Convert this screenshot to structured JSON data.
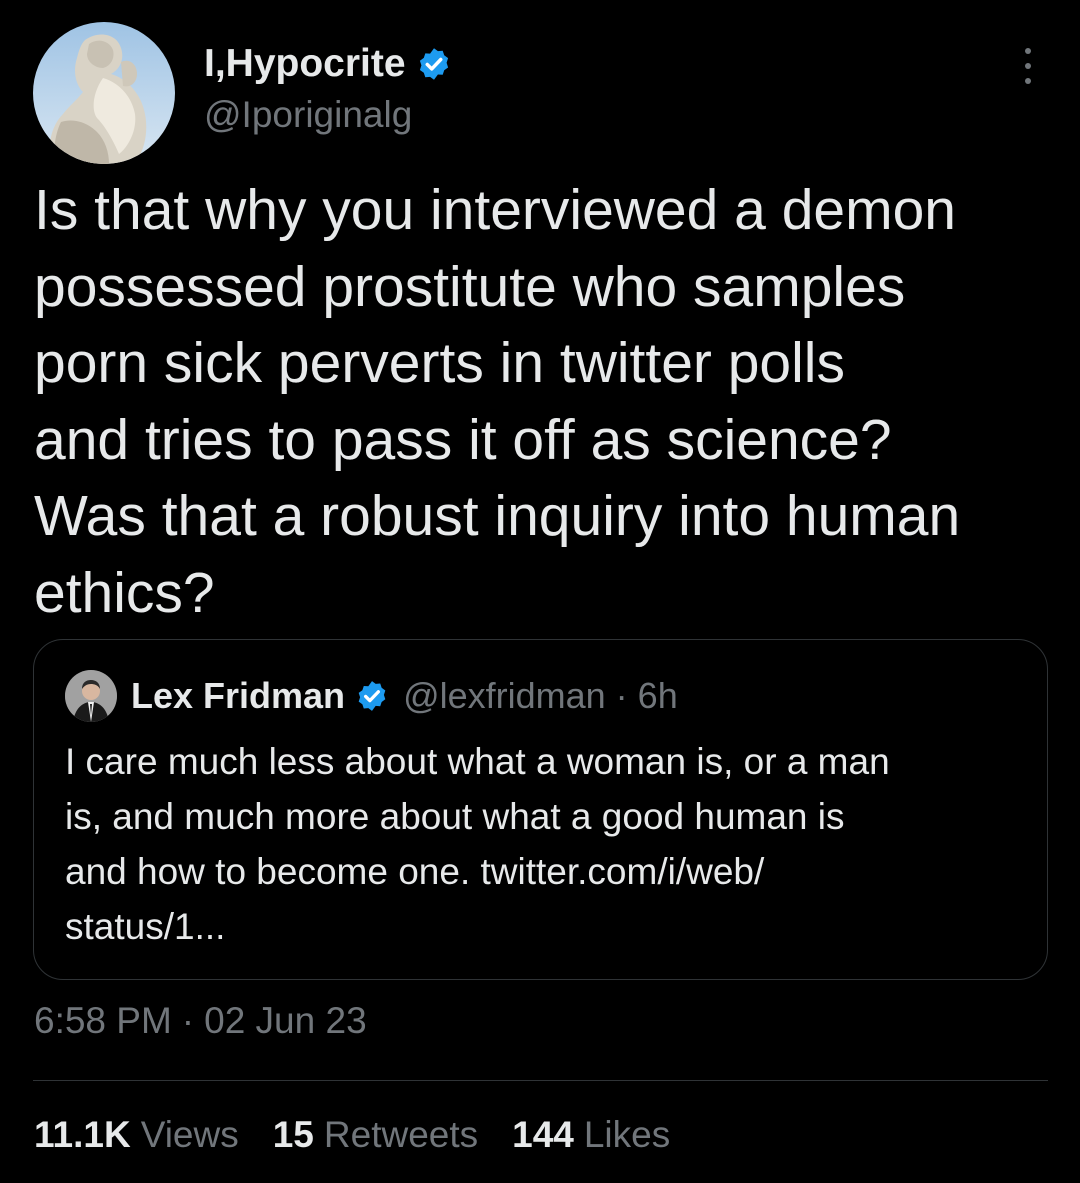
{
  "colors": {
    "background": "#000000",
    "text_primary": "#e7e9ea",
    "text_secondary": "#71767b",
    "border": "#2f3336",
    "verified_blue": "#1d9bf0"
  },
  "author": {
    "name": "I,Hypocrite",
    "handle": "@Iporiginalg",
    "verified": true,
    "avatar_icon": "statue-avatar"
  },
  "more_icon": "more-options-icon",
  "tweet_text": "Is that why you interviewed a demon\npossessed prostitute who samples\nporn sick perverts in twitter polls\nand tries to pass it off as science?\nWas that a robust inquiry into human\nethics?",
  "quote": {
    "name": "Lex Fridman",
    "verified": true,
    "handle": "@lexfridman",
    "separator": "·",
    "time": "6h",
    "text": "I care much less about what a woman is, or a man\nis, and much more about what a good human is\nand how to become one. twitter.com/i/web/\nstatus/1...",
    "avatar_icon": "person-in-suit-avatar"
  },
  "timestamp": {
    "time": "6:58 PM",
    "separator": "·",
    "date": "02 Jun 23"
  },
  "stats": {
    "views_count": "11.1K",
    "views_label": "Views",
    "retweets_count": "15",
    "retweets_label": "Retweets",
    "likes_count": "144",
    "likes_label": "Likes"
  }
}
